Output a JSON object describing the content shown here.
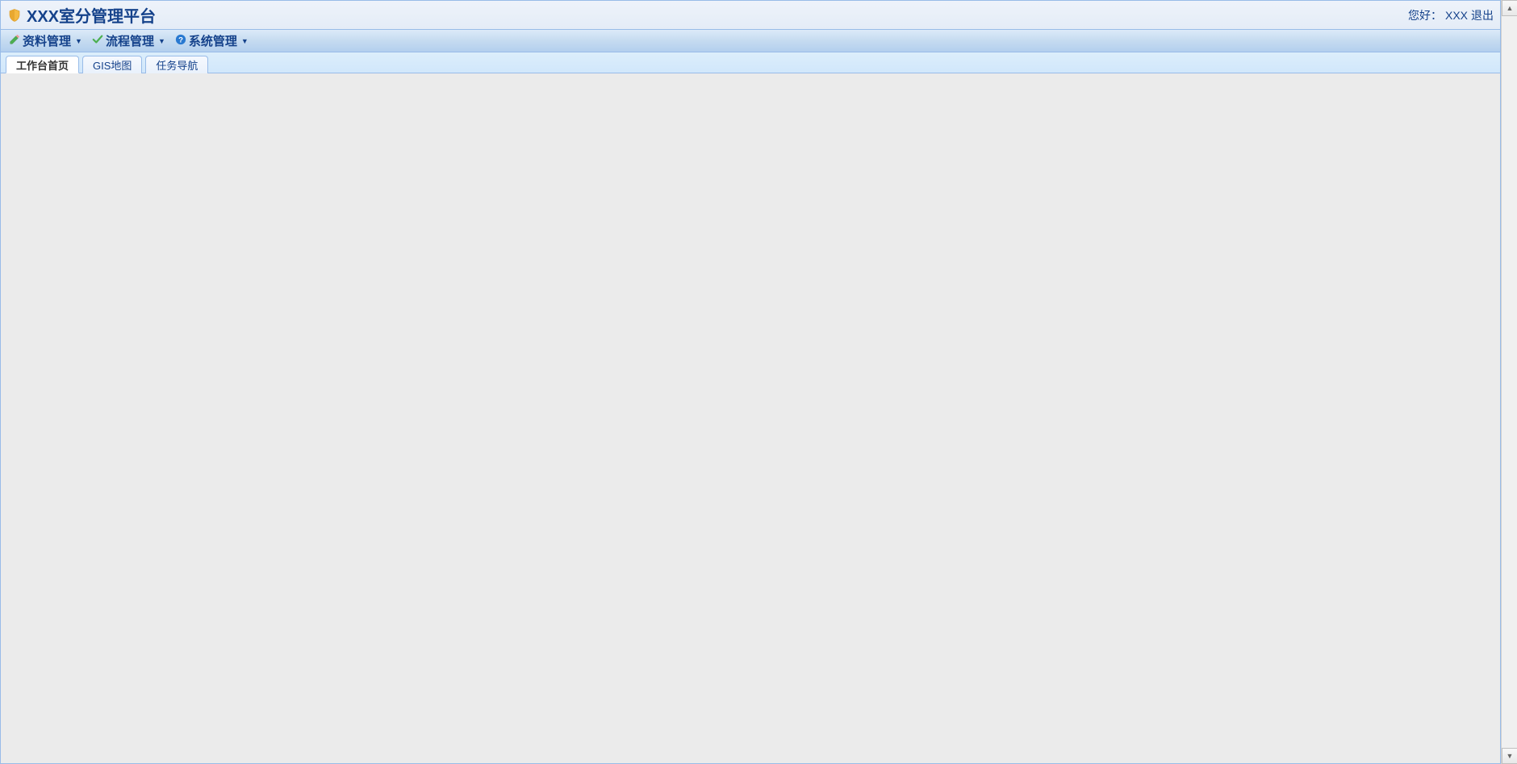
{
  "header": {
    "title": "XXX室分管理平台",
    "greeting_prefix": "您好：",
    "username": "XXX",
    "logout_label": "退出"
  },
  "menubar": {
    "items": [
      {
        "label": "资料管理",
        "icon": "pencil"
      },
      {
        "label": "流程管理",
        "icon": "check"
      },
      {
        "label": "系统管理",
        "icon": "help"
      }
    ]
  },
  "tabs": [
    {
      "label": "工作台首页",
      "active": true
    },
    {
      "label": "GIS地图",
      "active": false
    },
    {
      "label": "任务导航",
      "active": false
    }
  ]
}
